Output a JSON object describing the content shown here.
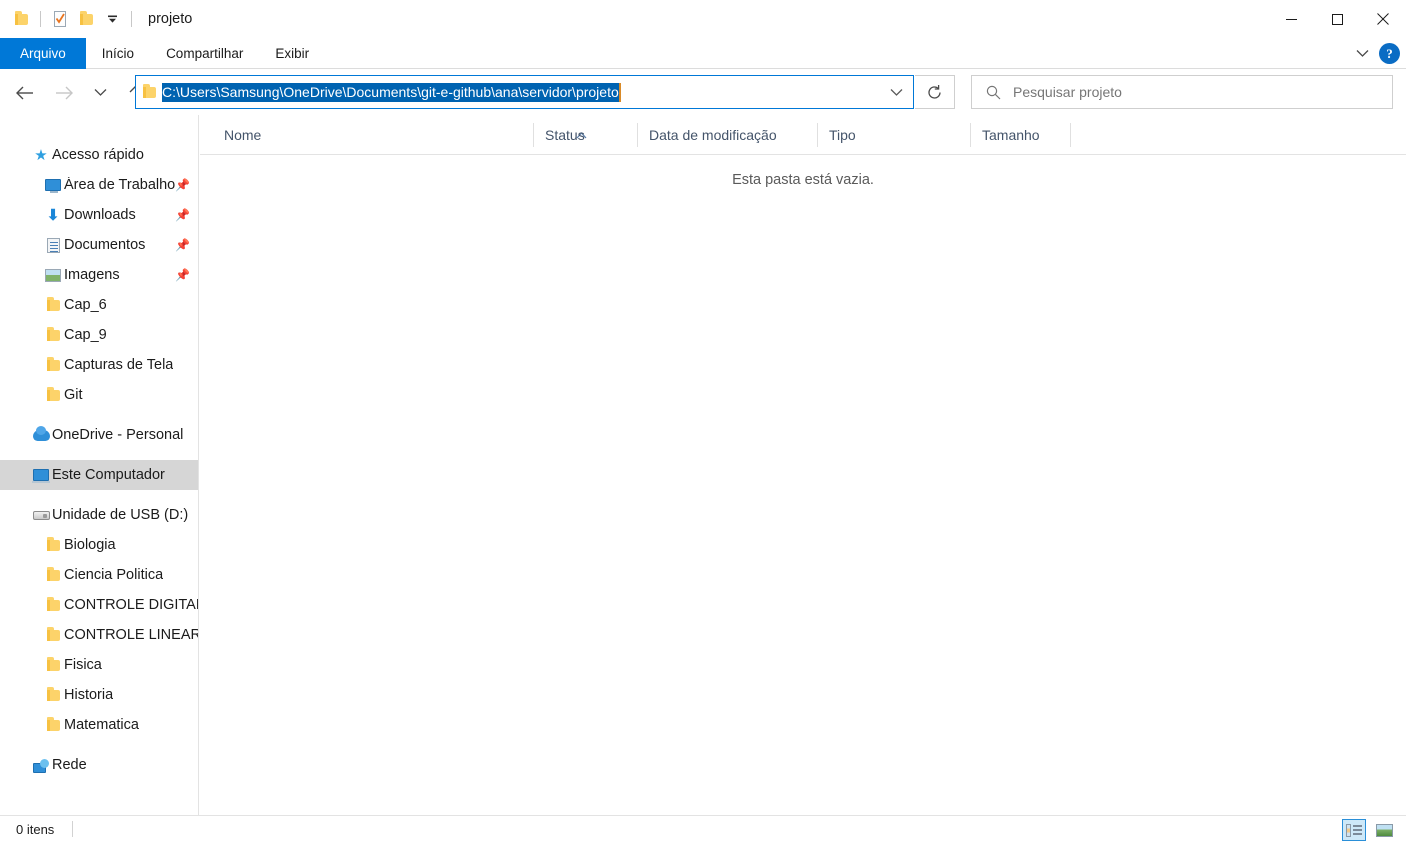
{
  "window": {
    "title": "projeto",
    "quick_access_toolbar": [
      {
        "name": "folder-icon",
        "label": ""
      },
      {
        "name": "properties-icon",
        "label": ""
      },
      {
        "name": "new-folder-icon",
        "label": ""
      },
      {
        "name": "customize-qat-chevron-icon",
        "label": "▾"
      }
    ],
    "controls": {
      "minimize": "—",
      "maximize": "□",
      "close": "✕"
    }
  },
  "ribbon": {
    "tabs": [
      {
        "label": "Arquivo",
        "active": true
      },
      {
        "label": "Início",
        "active": false
      },
      {
        "label": "Compartilhar",
        "active": false
      },
      {
        "label": "Exibir",
        "active": false
      }
    ],
    "collapse_chevron": "∨",
    "help_label": "?"
  },
  "toolbar": {
    "back_arrow": "←",
    "forward_arrow": "→",
    "recent_chevron": "∨",
    "up_arrow": "↑",
    "refresh_glyph": "↻",
    "address": {
      "value": "C:\\Users\\Samsung\\OneDrive\\Documents\\git-e-github\\ana\\servidor\\projeto",
      "selected": true,
      "dropdown_chevron": "∨"
    },
    "search": {
      "placeholder": "Pesquisar projeto",
      "value": "",
      "icon": "search-icon"
    }
  },
  "sidebar": {
    "groups": [
      {
        "header": {
          "label": "Acesso rápido",
          "icon": "star-icon"
        },
        "items": [
          {
            "label": "Área de Trabalho",
            "icon": "monitor-icon",
            "pinned": true,
            "pin": "📌"
          },
          {
            "label": "Downloads",
            "icon": "download-icon",
            "pinned": true,
            "pin": "📌"
          },
          {
            "label": "Documentos",
            "icon": "document-icon",
            "pinned": true,
            "pin": "📌"
          },
          {
            "label": "Imagens",
            "icon": "picture-icon",
            "pinned": true,
            "pin": "📌"
          },
          {
            "label": "Cap_6",
            "icon": "folder-icon",
            "pinned": false
          },
          {
            "label": "Cap_9",
            "icon": "folder-icon",
            "pinned": false
          },
          {
            "label": "Capturas de Tela",
            "icon": "folder-icon",
            "pinned": false
          },
          {
            "label": "Git",
            "icon": "folder-icon",
            "pinned": false
          }
        ]
      },
      {
        "header": {
          "label": "OneDrive - Personal",
          "icon": "cloud-icon"
        },
        "items": []
      },
      {
        "header": {
          "label": "Este Computador",
          "icon": "computer-icon",
          "selected": true
        },
        "items": []
      },
      {
        "header": {
          "label": "Unidade de USB (D:)",
          "icon": "usb-drive-icon"
        },
        "items": [
          {
            "label": "Biologia",
            "icon": "folder-icon",
            "pinned": false
          },
          {
            "label": "Ciencia Politica",
            "icon": "folder-icon",
            "pinned": false
          },
          {
            "label": "CONTROLE DIGITAL",
            "icon": "folder-icon",
            "pinned": false
          },
          {
            "label": "CONTROLE LINEAR",
            "icon": "folder-icon",
            "pinned": false
          },
          {
            "label": "Fisica",
            "icon": "folder-icon",
            "pinned": false
          },
          {
            "label": "Historia",
            "icon": "folder-icon",
            "pinned": false
          },
          {
            "label": "Matematica",
            "icon": "folder-icon",
            "pinned": false
          }
        ]
      },
      {
        "header": {
          "label": "Rede",
          "icon": "network-icon"
        },
        "items": []
      }
    ]
  },
  "filelist": {
    "columns": [
      {
        "label": "Nome",
        "sorted": "asc",
        "sort_caret": "ⱏ"
      },
      {
        "label": "Status"
      },
      {
        "label": "Data de modificação"
      },
      {
        "label": "Tipo"
      },
      {
        "label": "Tamanho"
      }
    ],
    "rows": [],
    "empty_message": "Esta pasta está vazia."
  },
  "statusbar": {
    "item_count": "0 itens",
    "view_details_icon": "details-view-icon",
    "view_large_icons_icon": "large-icons-view-icon"
  },
  "colors": {
    "accent": "#0078d7",
    "selection": "#0063b1",
    "folder": "#fcd36a",
    "header_text": "#44546a"
  }
}
